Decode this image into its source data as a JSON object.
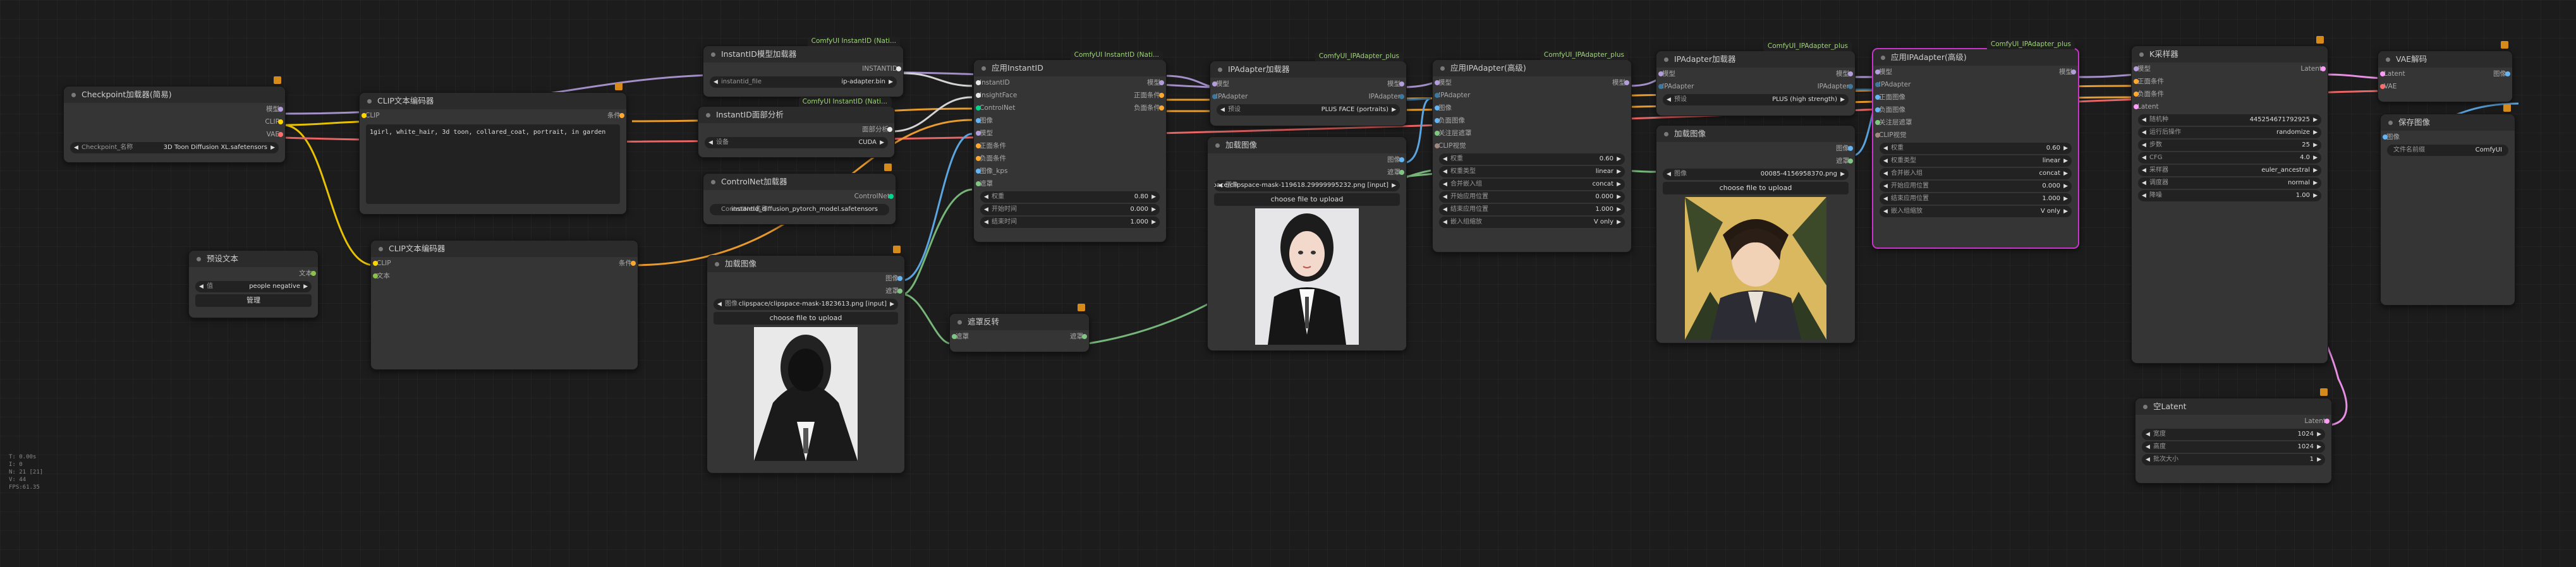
{
  "colors": {
    "model": "#b39ddb",
    "clip": "#ffd500",
    "vae": "#ff6e6e",
    "cond": "#ffa931",
    "image": "#64b5f6",
    "mask": "#81c784",
    "latent": "#ff9cf9",
    "ipa": "#3f789e",
    "insight": "#e8e8e8",
    "selected": "#c834c8"
  },
  "checkpoint": {
    "title": "Checkpoint加载器(简易)",
    "out_model": "模型",
    "out_clip": "CLIP",
    "out_vae": "VAE",
    "w_label": "Checkpoint_名称",
    "w_value": "3D Toon Diffusion XL.safetensors"
  },
  "clip1": {
    "title": "CLIP文本编码器",
    "in_clip": "CLIP",
    "out": "条件",
    "text": "1girl, white_hair, 3d toon, collared_coat, portrait, in garden"
  },
  "clip2": {
    "title": "CLIP文本编码器",
    "in_clip": "CLIP",
    "in_text": "文本",
    "out": "条件"
  },
  "preset": {
    "title": "预设文本",
    "out": "文本",
    "w_label": "值",
    "w_value": "people negative",
    "btn": "管理"
  },
  "iid_loader": {
    "badge": "ComfyUI InstantID (Nati...",
    "title": "InstantID模型加载器",
    "out": "INSTANTID",
    "w_label": "instantid_file",
    "w_value": "ip-adapter.bin"
  },
  "face": {
    "badge": "ComfyUI InstantID (Nati...",
    "title": "InstantID面部分析",
    "out": "面部分析",
    "w_label": "设备",
    "w_value": "CUDA"
  },
  "cn_loader": {
    "title": "ControlNet加载器",
    "out": "ControlNet",
    "w_label": "ControlNet名称",
    "w_value": "instantid_diffusion_pytorch_model.safetensors"
  },
  "load1": {
    "title": "加载图像",
    "out_img": "图像",
    "out_mask": "遮罩",
    "w_label": "图像",
    "w_value": "clipspace/clipspace-mask-1823613.png [input]",
    "btn": "choose file to upload"
  },
  "invert": {
    "title": "遮罩反转",
    "in": "遮罩",
    "out": "遮罩"
  },
  "apply_iid": {
    "badge": "ComfyUI InstantID (Nati...",
    "title": "应用InstantID",
    "ins": [
      "InstantID",
      "InsightFace",
      "ControlNet",
      "图像",
      "模型",
      "正面条件",
      "负面条件",
      "图像_kps",
      "遮罩"
    ],
    "outs": [
      "模型",
      "正面条件",
      "负面条件"
    ],
    "w": [
      {
        "l": "权重",
        "v": "0.80"
      },
      {
        "l": "开始时间",
        "v": "0.000"
      },
      {
        "l": "结束时间",
        "v": "1.000"
      }
    ]
  },
  "ipa_loader": {
    "badge": "ComfyUI_IPAdapter_plus",
    "title": "IPAdapter加载器",
    "in_model": "模型",
    "out_model": "模型",
    "out_ipa": "IPAdapter",
    "in_ipa": "IPAdapter",
    "w_label": "预设",
    "w_value": "PLUS FACE (portraits)"
  },
  "load2": {
    "title": "加载图像",
    "out_img": "图像",
    "out_mask": "遮罩",
    "w_label": "图像",
    "w_value": "clipspace/clipspace-mask-119618.29999995232.png [input]",
    "btn": "choose file to upload"
  },
  "adv1": {
    "badge": "ComfyUI_IPAdapter_plus",
    "title": "应用IPAdapter(高级)",
    "ins": [
      "模型",
      "IPAdapter",
      "图像",
      "负面图像",
      "关注层遮罩",
      "CLIP视觉"
    ],
    "out": "模型",
    "w": [
      {
        "l": "权重",
        "v": "0.60"
      },
      {
        "l": "权重类型",
        "v": "linear"
      },
      {
        "l": "合并嵌入组",
        "v": "concat"
      },
      {
        "l": "开始应用位置",
        "v": "0.000"
      },
      {
        "l": "结束应用位置",
        "v": "1.000"
      },
      {
        "l": "嵌入组缩放",
        "v": "V only"
      }
    ]
  },
  "ipa_loader2": {
    "badge": "ComfyUI_IPAdapter_plus",
    "title": "IPAdapter加载器",
    "in_model": "模型",
    "in_ipa": "IPAdapter",
    "out_model": "模型",
    "out_ipa": "IPAdapter",
    "w_label": "预设",
    "w_value": "PLUS (high strength)"
  },
  "load3": {
    "title": "加载图像",
    "out_img": "图像",
    "out_mask": "遮罩",
    "w_label": "图像",
    "w_value": "00085-4156958370.png",
    "btn": "choose file to upload"
  },
  "adv2": {
    "badge": "ComfyUI_IPAdapter_plus",
    "title": "应用IPAdapter(高级)",
    "ins": [
      "模型",
      "IPAdapter",
      "正面图像",
      "负面图像",
      "关注层遮罩",
      "CLIP视觉"
    ],
    "out": "模型",
    "w": [
      {
        "l": "权重",
        "v": "0.60"
      },
      {
        "l": "权重类型",
        "v": "linear"
      },
      {
        "l": "合并嵌入组",
        "v": "concat"
      },
      {
        "l": "开始应用位置",
        "v": "0.000"
      },
      {
        "l": "结束应用位置",
        "v": "1.000"
      },
      {
        "l": "嵌入组缩放",
        "v": "V only"
      }
    ]
  },
  "ksampler": {
    "title": "K采样器",
    "ins": [
      "模型",
      "正面条件",
      "负面条件",
      "Latent"
    ],
    "out": "Latent",
    "w": [
      {
        "l": "随机种",
        "v": "445254671792925"
      },
      {
        "l": "运行后操作",
        "v": "randomize"
      },
      {
        "l": "步数",
        "v": "25"
      },
      {
        "l": "CFG",
        "v": "4.0"
      },
      {
        "l": "采样器",
        "v": "euler_ancestral"
      },
      {
        "l": "调度器",
        "v": "normal"
      },
      {
        "l": "降噪",
        "v": "1.00"
      }
    ]
  },
  "empty": {
    "title": "空Latent",
    "out": "Latent",
    "w": [
      {
        "l": "宽度",
        "v": "1024"
      },
      {
        "l": "高度",
        "v": "1024"
      },
      {
        "l": "批次大小",
        "v": "1"
      }
    ]
  },
  "vae": {
    "title": "VAE解码",
    "in_samples": "Latent",
    "in_vae": "VAE",
    "out": "图像"
  },
  "save": {
    "title": "保存图像",
    "in": "图像",
    "w_label": "文件名前缀",
    "w_value": "ComfyUI"
  },
  "stats": [
    "T: 0.00s",
    "I: 0",
    "N: 21 [21]",
    "V: 44",
    "FPS:61.35"
  ]
}
